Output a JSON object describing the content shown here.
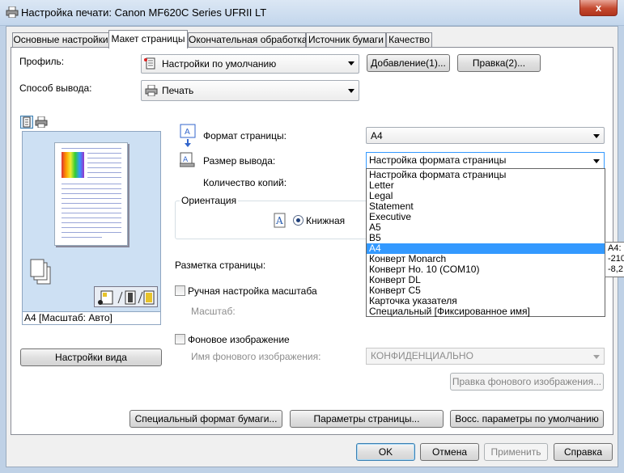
{
  "window": {
    "title": "Настройка печати: Canon MF620C Series UFRII LT",
    "close_glyph": "x"
  },
  "tabs": [
    {
      "label": "Основные настройки",
      "active": false
    },
    {
      "label": "Макет страницы",
      "active": true
    },
    {
      "label": "Окончательная обработка",
      "active": false
    },
    {
      "label": "Источник бумаги",
      "active": false
    },
    {
      "label": "Качество",
      "active": false
    }
  ],
  "profile": {
    "label": "Профиль:",
    "value": "Настройки по умолчанию",
    "add_button": "Добавление(1)...",
    "edit_button": "Правка(2)..."
  },
  "output_method": {
    "label": "Способ вывода:",
    "value": "Печать"
  },
  "preview": {
    "caption": "A4 [Масштаб: Авто]",
    "settings_button": "Настройки вида"
  },
  "page_format": {
    "label": "Формат страницы:",
    "value": "A4"
  },
  "output_size": {
    "label": "Размер вывода:",
    "value": "Настройка формата страницы",
    "options": [
      "Настройка формата страницы",
      "Letter",
      "Legal",
      "Statement",
      "Executive",
      "A5",
      "B5",
      "A4",
      "Конверт Monarch",
      "Конверт Но. 10 (COM10)",
      "Конверт DL",
      "Конверт C5",
      "Карточка указателя",
      "Специальный [Фиксированное имя]"
    ],
    "highlighted": "A4",
    "tooltip_lines": [
      "A4:",
      "-210",
      "-8,2"
    ]
  },
  "copies": {
    "label": "Количество копий:"
  },
  "orientation": {
    "group_label": "Ориентация",
    "option_label": "Книжная",
    "selected": true
  },
  "page_layout": {
    "label": "Разметка страницы:"
  },
  "manual_scale": {
    "label": "Ручная настройка масштаба",
    "checked": false,
    "scale_label": "Масштаб:"
  },
  "watermark": {
    "label": "Фоновое изображение",
    "checked": false,
    "name_label": "Имя фонового изображения:",
    "name_value": "КОНФИДЕНЦИАЛЬНО",
    "edit_button": "Правка фонового изображения..."
  },
  "bottom_buttons": {
    "custom_paper": "Специальный формат бумаги...",
    "page_options": "Параметры страницы...",
    "restore_defaults": "Восс. параметры по умолчанию"
  },
  "dialog_buttons": {
    "ok": "OK",
    "cancel": "Отмена",
    "apply": "Применить",
    "help": "Справка"
  },
  "colors": {
    "selection": "#3399ff",
    "client_bg": "#f0f0f0",
    "title_bar": "#c3d6ec"
  }
}
